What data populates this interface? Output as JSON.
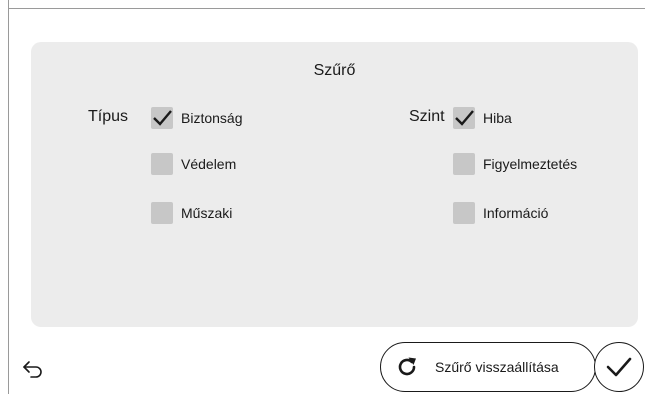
{
  "dialog": {
    "title": "Szűrő",
    "type_group": {
      "label": "Típus",
      "options": [
        {
          "label": "Biztonság",
          "checked": true
        },
        {
          "label": "Védelem",
          "checked": false
        },
        {
          "label": "Műszaki",
          "checked": false
        }
      ]
    },
    "level_group": {
      "label": "Szint",
      "options": [
        {
          "label": "Hiba",
          "checked": true
        },
        {
          "label": "Figyelmeztetés",
          "checked": false
        },
        {
          "label": "Információ",
          "checked": false
        }
      ]
    }
  },
  "footer": {
    "back_icon": "back-arrow-icon",
    "reset_label": "Szűrő visszaállítása",
    "reset_icon": "refresh-icon",
    "confirm_icon": "checkmark-icon"
  },
  "colors": {
    "panel_bg": "#ececec",
    "checkbox_bg": "#c7c7c7",
    "text": "#1a1a1a"
  }
}
